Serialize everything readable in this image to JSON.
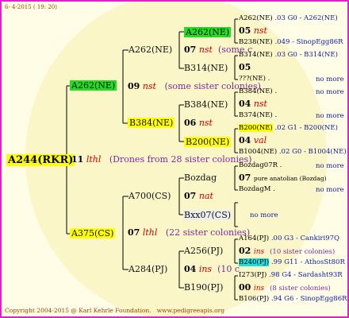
{
  "header": {
    "date": "6- 4-2015 ( 19: 20)"
  },
  "footer": {
    "copyright": "Copyright 2004-2015 @ Karl Kehrle Foundation.",
    "site": "www.pedigreeapis.org"
  },
  "root": {
    "label": "A244(RKR)"
  },
  "gen1": {
    "top": {
      "label": "A262(NE)"
    },
    "mid": {
      "num": "11",
      "ital": "lthl",
      "sis": "(Drones from 28 sister colonies)"
    },
    "bottom": {
      "label": "A375(CS)"
    }
  },
  "gen2": {
    "a262": {
      "num": "09",
      "ital": "nst",
      "sis": "(some sister colonies)"
    },
    "a375": {
      "num": "07",
      "ital": "lthl",
      "sis": "(22 sister colonies)"
    }
  },
  "gen3": {
    "a262ne": {
      "label": "A262(NE)",
      "num": "07",
      "ital": "nst",
      "sis": "(some c"
    },
    "b314": {
      "label": "B314(NE)"
    },
    "b384": {
      "label": "B384(NE)",
      "num": "06",
      "ital": "nst"
    },
    "b200": {
      "label": "B200(NE)"
    },
    "a700": {
      "label": "A700(CS)",
      "num": "07",
      "ital": "nat"
    },
    "bozdag": {
      "label": "Bozdag"
    },
    "bxx07": {
      "label": "Bxx07(CS)",
      "more": "no more"
    },
    "a284": {
      "label": "A284(PJ)",
      "num": "04",
      "ital": "ins",
      "sis": "(10 c"
    },
    "a256": {
      "label": "A256(PJ)"
    },
    "b190": {
      "label": "B190(PJ)"
    }
  },
  "gen4": {
    "r1": {
      "label": "A262(NE)",
      "text": ".03  G0 - A262(NE)"
    },
    "r2": {
      "num": "05",
      "ital": "nst"
    },
    "r3": {
      "label": "B238(NE)",
      "text": ".049 - SinopEgg86R"
    },
    "r4": {
      "label": "B314(NE)",
      "text": ".03  G0 - B314(NE)"
    },
    "r5": {
      "num": "05"
    },
    "r6": {
      "label": "???(NE)",
      "text": ".",
      "more": "no more"
    },
    "r7": {
      "label": "B384(NE)",
      "text": ".",
      "more": "no more"
    },
    "r8": {
      "num": "04",
      "ital": "nst"
    },
    "r9": {
      "label": "B374(NE)",
      "text": ".",
      "more": "no more"
    },
    "r10": {
      "label": "B200(NE)",
      "text": ".02   G1 - B200(NE)"
    },
    "r11": {
      "num": "04",
      "ital": "val"
    },
    "r12": {
      "label": "B1004(NE)",
      "text": ".02 G0 - B1004(NE)"
    },
    "r13": {
      "label": "Bozdag07R",
      "text": ".",
      "more": "no more"
    },
    "r14": {
      "num": "07",
      "text": "pure anatolian (Bozdag)"
    },
    "r15": {
      "label": "BozdagM",
      "text": ".",
      "more": "no more"
    },
    "r16": {
      "label": "A164(PJ)",
      "text": ".00   G3 - Cankiri97Q"
    },
    "r17": {
      "num": "02",
      "ital": "ins",
      "sis": "(10 sister colonies)"
    },
    "r18": {
      "label": "B240(PJ)",
      "text": ".99 G11 - AthosSt80R"
    },
    "r19": {
      "label": "I273(PJ)",
      "text": ".98   G4 - Sardasht93R"
    },
    "r20": {
      "num": "00",
      "ital": "ins",
      "sis": "(8 sister colonies)"
    },
    "r21": {
      "label": "B106(PJ)",
      "text": ".94 G6 - SinopEgg86R"
    }
  }
}
